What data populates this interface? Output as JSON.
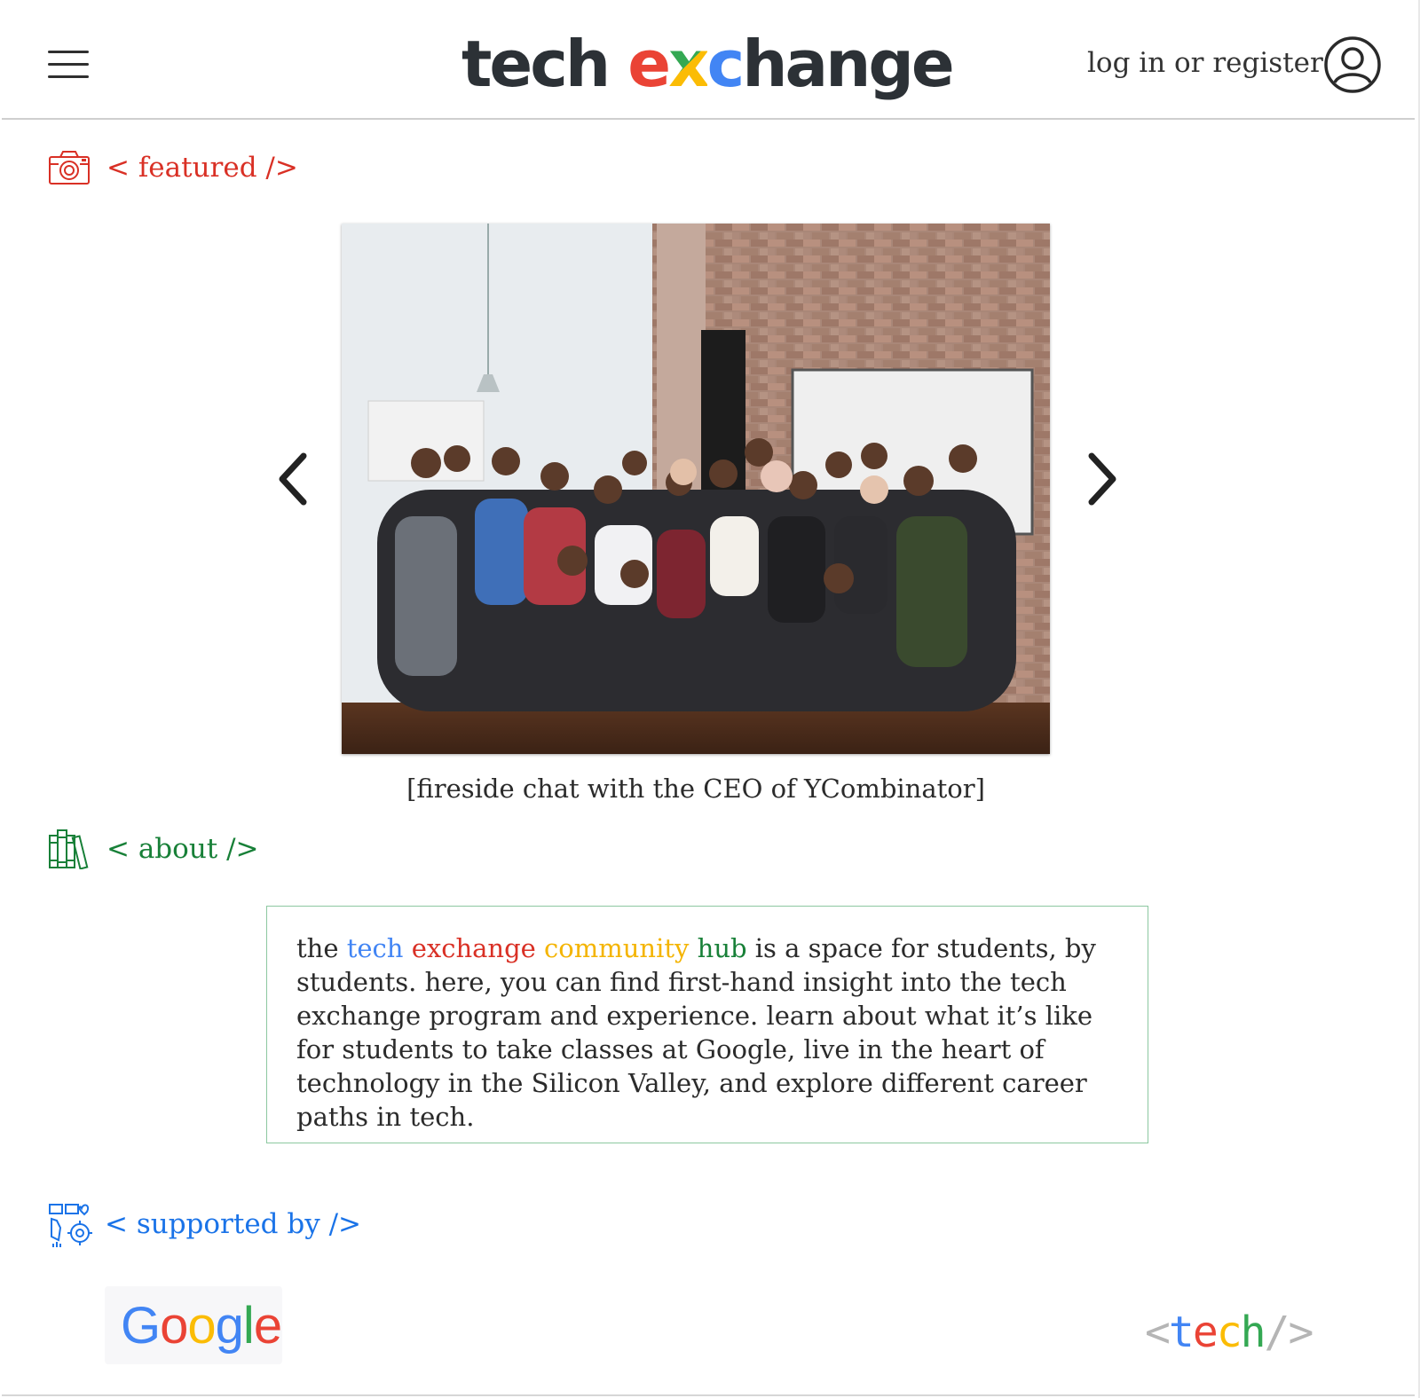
{
  "header": {
    "logo": {
      "part1": "tech ",
      "e": "e",
      "x": "x",
      "c": "c",
      "rest": "hange"
    },
    "login_label": "log in or register"
  },
  "featured": {
    "heading": "< featured />",
    "caption": "[fireside chat with the CEO of YCombinator]"
  },
  "about": {
    "heading": "< about />",
    "intro": "the",
    "w1": "tech",
    "w2": "exchange",
    "w3": "community",
    "w4": "hub",
    "body": "is a space for students, by students. here, you can find first-hand insight into the tech exchange program and experience. learn about what it’s like for students to take classes at Google, live in the heart of technology in the Silicon Valley, and explore different career paths in tech."
  },
  "supported": {
    "heading": "< supported by />",
    "google": {
      "g1": "G",
      "o1": "o",
      "o2": "o",
      "g2": "g",
      "l": "l",
      "e": "e"
    },
    "tech": {
      "lt": "<",
      "t": "t",
      "e": "e",
      "c": "c",
      "h": "h",
      "slash": "/",
      "gt": ">"
    }
  },
  "colors": {
    "blue": "#4285f4",
    "red": "#ea4335",
    "yellow": "#fbbc05",
    "green": "#34a853",
    "featured_red": "#d93025",
    "about_green": "#188038",
    "supported_blue": "#1a73e8"
  },
  "icons": [
    "menu-icon",
    "user-account-icon",
    "camera-icon",
    "books-icon",
    "support-gear-icon",
    "chevron-left-icon",
    "chevron-right-icon"
  ]
}
